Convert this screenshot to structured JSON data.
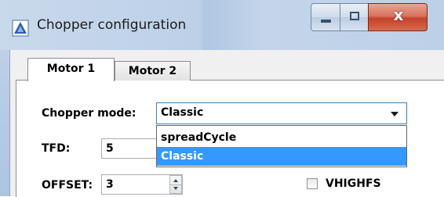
{
  "window": {
    "title": "Chopper configuration",
    "accent_color": "#3399ff"
  },
  "title_buttons": {
    "minimize_icon": "minimize-icon",
    "maximize_icon": "maximize-icon",
    "close_glyph": "x"
  },
  "tabs": [
    {
      "label": "Motor 1",
      "active": true
    },
    {
      "label": "Motor 2",
      "active": false
    }
  ],
  "chopper_mode": {
    "label": "Chopper mode:",
    "selected": "Classic",
    "options": [
      "spreadCycle",
      "Classic"
    ],
    "highlighted_option": "Classic"
  },
  "tfd": {
    "label": "TFD:",
    "value": "5"
  },
  "offset": {
    "label": "OFFSET:",
    "value": "3"
  },
  "vhighfs": {
    "label": "VHIGHFS",
    "checked": false
  }
}
